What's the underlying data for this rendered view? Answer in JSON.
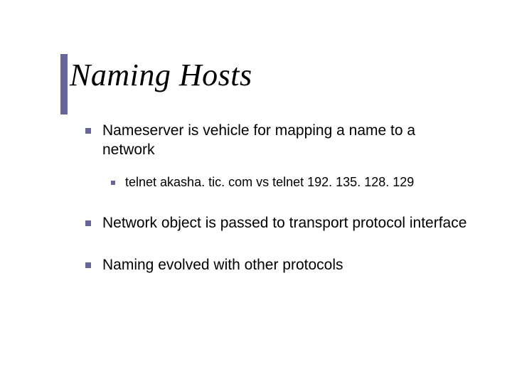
{
  "title": "Naming Hosts",
  "bullets": {
    "b1": "Nameserver is vehicle for mapping a name to a network",
    "b1a": "telnet akasha. tic. com vs telnet 192. 135. 128. 129",
    "b2": "Network object is passed to transport protocol interface",
    "b3": "Naming evolved with other protocols"
  },
  "accent_color": "#666699"
}
